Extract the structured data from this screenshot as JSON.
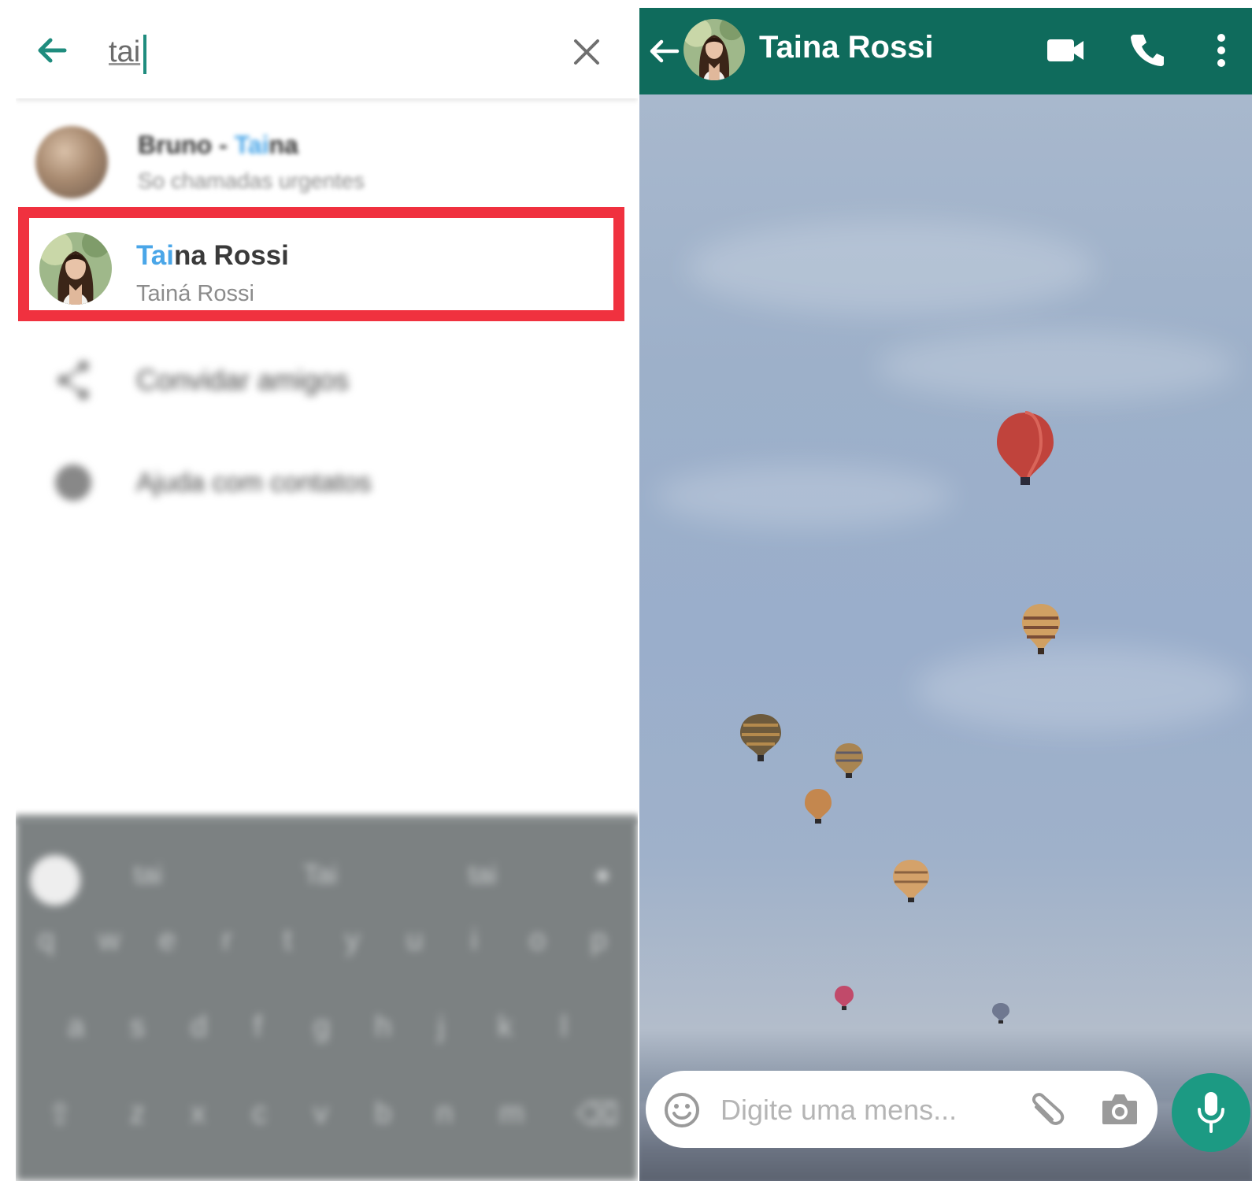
{
  "search": {
    "query": "tai",
    "query_highlight": "Tai"
  },
  "results": [
    {
      "name_highlight": "Bruno - Taina",
      "name_prefix": "Bruno - ",
      "name_match": "Tai",
      "name_rest": "na",
      "subtitle": "So chamadas urgentes"
    },
    {
      "name_match": "Tai",
      "name_rest": "na Rossi",
      "subtitle": "Tainá Rossi"
    }
  ],
  "actions": {
    "invite_label": "Convidar amigos",
    "help_label": "Ajuda com contatos"
  },
  "keyboard": {
    "suggestions": [
      "tai",
      "Tai",
      "tai"
    ],
    "row1": [
      "q",
      "w",
      "e",
      "r",
      "t",
      "y",
      "u",
      "i",
      "o",
      "p"
    ],
    "row2": [
      "a",
      "s",
      "d",
      "f",
      "g",
      "h",
      "j",
      "k",
      "l"
    ],
    "row3": [
      "z",
      "x",
      "c",
      "v",
      "b",
      "n",
      "m"
    ]
  },
  "chat": {
    "contact_name": "Taina Rossi",
    "message_placeholder": "Digite uma mens..."
  },
  "colors": {
    "header_green": "#0f6b5c",
    "accent_teal": "#1f8c7e",
    "match_blue": "#4aa6e8",
    "highlight_red": "#f0313f",
    "mic_green": "#1c9a83"
  },
  "icons": {
    "back": "arrow-left-icon",
    "clear": "close-icon",
    "share": "share-icon",
    "help": "help-icon",
    "video": "video-camera-icon",
    "phone": "phone-icon",
    "more": "more-vertical-icon",
    "emoji": "emoji-icon",
    "attach": "paperclip-icon",
    "camera": "camera-icon",
    "mic": "microphone-icon"
  }
}
